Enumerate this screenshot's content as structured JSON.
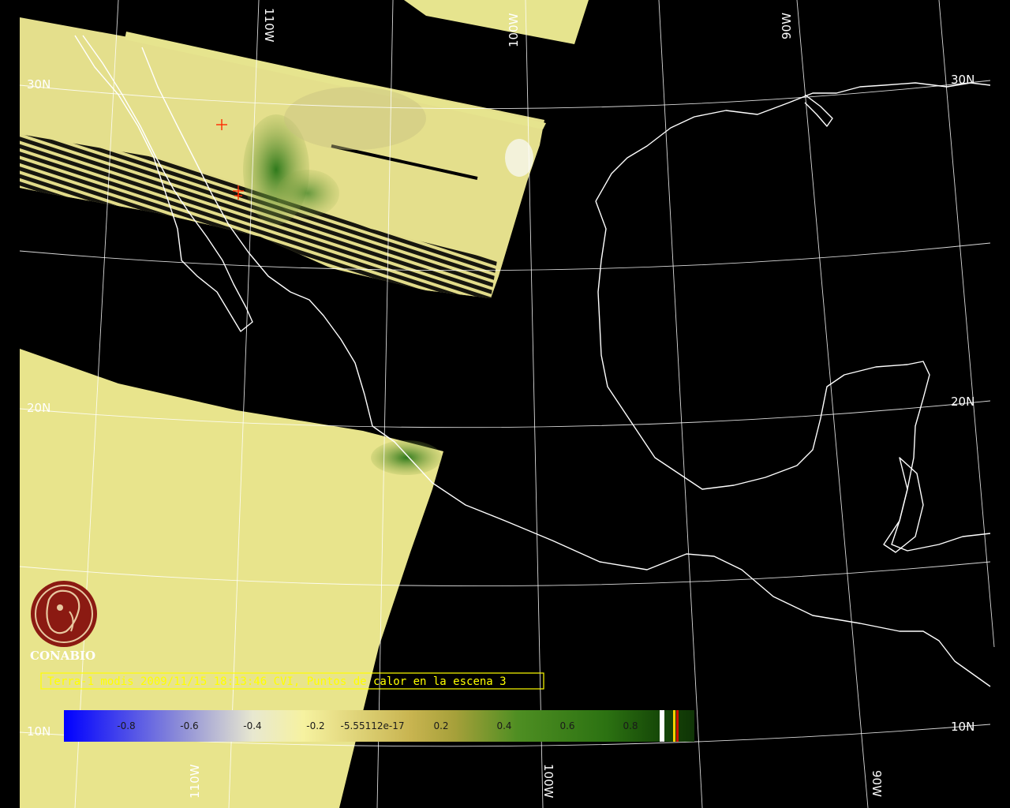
{
  "map": {
    "grid_labels": {
      "lat_30n_left": "30N",
      "lat_20n_left": "20N",
      "lat_10n_left": "10N",
      "lat_30n_right": "30N",
      "lat_20n_right": "20N",
      "lat_10n_right": "10N",
      "lon_110w_top": "110W",
      "lon_100w_top": "100W",
      "lon_90w_top": "90W",
      "lon_110w_bottom": "110W",
      "lon_100w_bottom": "100W",
      "lon_90w_bottom": "90W"
    },
    "caption": "Terra-1 modis 2009/11/15 18:13:46 CVI, Puntos de calor en la escena 3",
    "logo": {
      "name": "CONABIO",
      "color": "#8b1a12"
    },
    "colorbar": {
      "ticks": [
        "-0.8",
        "-0.6",
        "-0.4",
        "-0.2",
        "-5.55112e-17",
        "0.2",
        "0.4",
        "0.6",
        "0.8"
      ],
      "colors": {
        "start": "#0000ff",
        "mid_light": "#f4f0a0",
        "tan": "#b8a040",
        "green": "#2a7a10",
        "end": "#0f3a08"
      }
    },
    "colors": {
      "background": "#000000",
      "swath": "#e8e48c",
      "vegetation": "#3f8a28",
      "coastline": "#ffffff",
      "hotspot": "#ff2a00",
      "caption": "#ffff00"
    }
  }
}
